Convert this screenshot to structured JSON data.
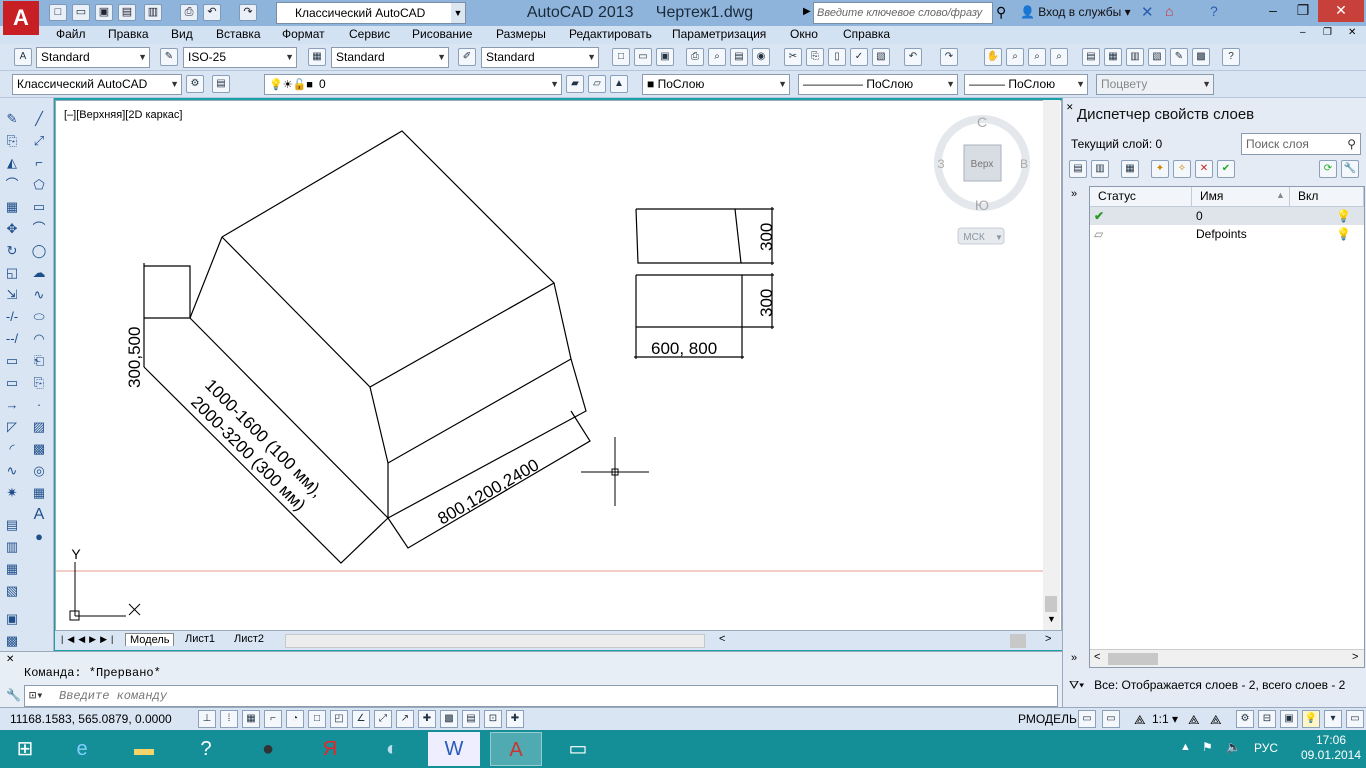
{
  "titlebar": {
    "workspace": "Классический AutoCAD",
    "app_name": "AutoCAD 2013",
    "document": "Чертеж1.dwg",
    "search_placeholder": "Введите ключевое слово/фразу",
    "login": "Вход в службы"
  },
  "menu": [
    "Файл",
    "Правка",
    "Вид",
    "Вставка",
    "Формат",
    "Сервис",
    "Рисование",
    "Размеры",
    "Редактировать",
    "Параметризация",
    "Окно",
    "Справка"
  ],
  "toolbar1": {
    "text_style": "Standard",
    "dim_style": "ISO-25",
    "table_style": "Standard",
    "mleader_style": "Standard"
  },
  "toolbar2": {
    "workspace": "Классический AutoCAD",
    "layer": "0",
    "color": "ПоСлою",
    "linetype": "ПоСлою",
    "lineweight": "ПоСлою",
    "plotstyle": "Поцвету"
  },
  "viewport": {
    "label": "[–][Верхняя][2D каркас]",
    "viewcube": {
      "north": "С",
      "south": "Ю",
      "west": "З",
      "east": "В",
      "top": "Верх",
      "ucs": "МСК"
    },
    "ucs_x": "X",
    "ucs_y": "Y"
  },
  "drawing": {
    "dim_left": "300,500",
    "label_line1": "1000-1600 (100 мм),",
    "label_line2": "2000-3200 (300 мм)",
    "dim_bottom": "800,1200,2400",
    "dim_300_a": "300",
    "dim_300_b": "300",
    "dim_600": "600, 800"
  },
  "tabs": [
    "Модель",
    "Лист1",
    "Лист2"
  ],
  "command": {
    "history": "Команда: *Прервано*",
    "placeholder": "Введите команду"
  },
  "layer_panel": {
    "title": "Диспетчер свойств слоев",
    "current_layer": "Текущий слой: 0",
    "search_placeholder": "Поиск слоя",
    "columns": [
      "Статус",
      "Имя",
      "Вкл"
    ],
    "rows": [
      {
        "name": "0",
        "current": true
      },
      {
        "name": "Defpoints",
        "current": false
      }
    ],
    "footer": "Все: Отображается слоев - 2, всего слоев - 2"
  },
  "statusbar": {
    "coords": "11168.1583, 565.0879, 0.0000",
    "model": "РМОДЕЛЬ",
    "scale": "1:1"
  },
  "taskbar": {
    "lang": "РУС",
    "time": "17:06",
    "date": "09.01.2014"
  }
}
